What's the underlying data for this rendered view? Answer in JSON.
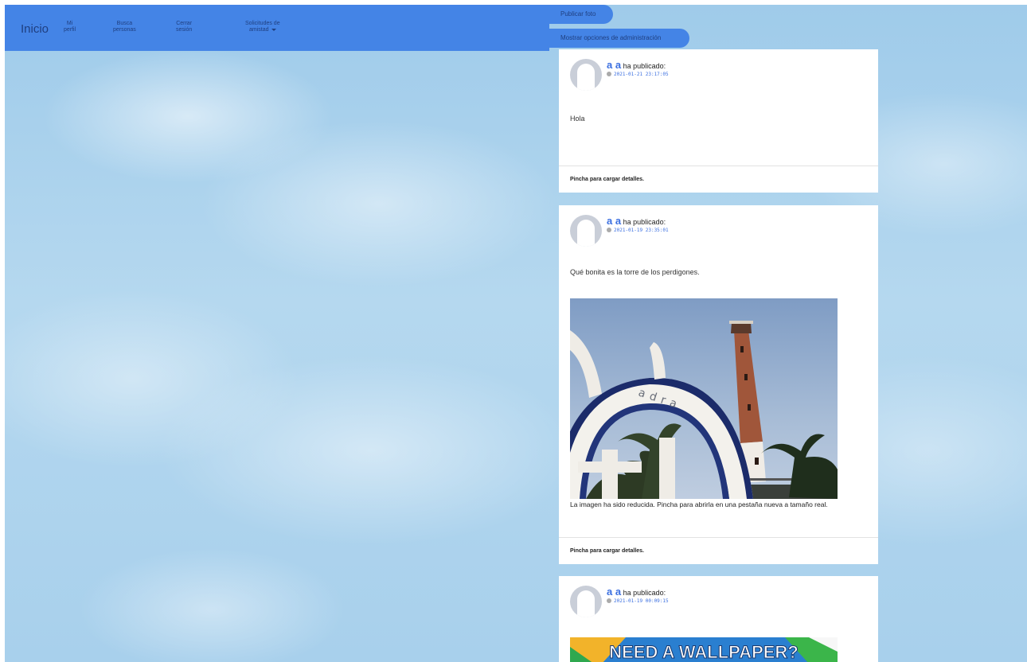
{
  "nav": {
    "brand": "Inicio",
    "profile_line1": "Mi",
    "profile_line2": "perfil",
    "search_line1": "Busca",
    "search_line2": "personas",
    "logout_line1": "Cerrar",
    "logout_line2": "sesión",
    "requests_line1": "Solicitudes de",
    "requests_line2": "amistad"
  },
  "actions": {
    "publish_photo": "Publicar foto",
    "admin_options": "Mostrar opciones de administración"
  },
  "posts": [
    {
      "author": "a a",
      "verb": "ha publicado:",
      "timestamp": "2021-01-21 23:17:05",
      "text": "Hola",
      "footer": "Pincha para cargar detalles."
    },
    {
      "author": "a a",
      "verb": "ha publicado:",
      "timestamp": "2021-01-19 23:35:01",
      "text": "Qué bonita es la torre de los perdigones.",
      "photo_caption": "adra",
      "reduced_note": "La imagen ha sido reducida. Pincha para abrirla en una pestaña nueva a tamaño real.",
      "footer": "Pincha para cargar detalles."
    },
    {
      "author": "a a",
      "verb": "ha publicado:",
      "timestamp": "2021-01-19 00:09:15",
      "banner_text": "NEED A WALLPAPER?"
    }
  ],
  "colors": {
    "nav_bg": "#4484e6",
    "nav_text": "#1f3f80",
    "author_link": "#3b6fe0",
    "card_bg": "#ffffff"
  }
}
